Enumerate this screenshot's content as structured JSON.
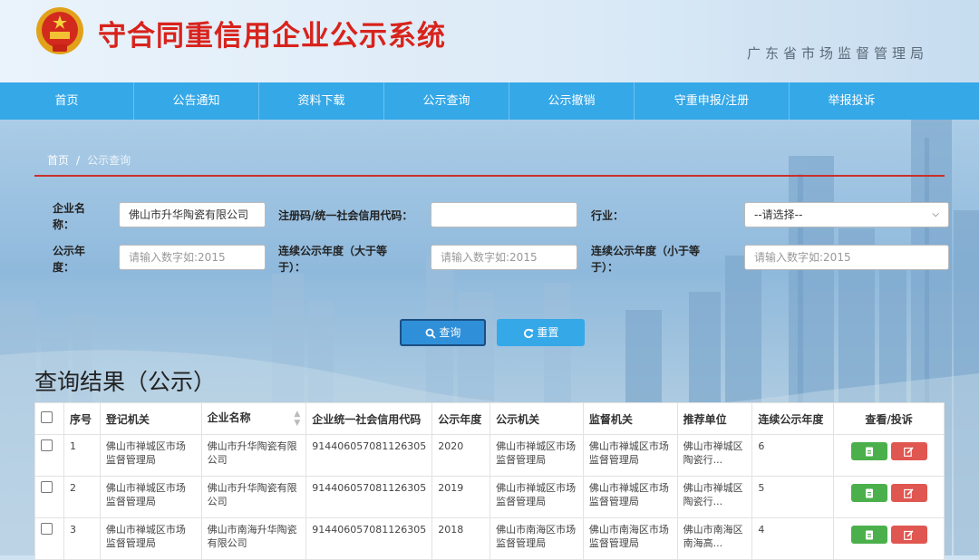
{
  "header": {
    "title": "守合同重信用企业公示系统",
    "authority": "广东省市场监督管理局"
  },
  "nav": [
    "首页",
    "公告通知",
    "资料下载",
    "公示查询",
    "公示撤销",
    "守重申报/注册",
    "举报投诉"
  ],
  "breadcrumb": {
    "home": "首页",
    "separator": "/",
    "current": "公示查询"
  },
  "form": {
    "company_label_1": "企业名",
    "company_label_2": "称：",
    "company_value": "佛山市升华陶瓷有限公司",
    "credit_code_label": "注册码/统一社会信用代码：",
    "credit_code_value": "",
    "industry_label": "行业：",
    "industry_selected": "--请选择--",
    "year_label_1": "公示年",
    "year_label_2": "度：",
    "year_placeholder": "请输入数字如:2015",
    "consec_gt_label_1": "连续公示年度（大于等",
    "consec_gt_label_2": "于）：",
    "consec_gt_placeholder": "请输入数字如:2015",
    "consec_lt_label_1": "连续公示年度（小于等",
    "consec_lt_label_2": "于）：",
    "consec_lt_placeholder": "请输入数字如:2015",
    "query_label": "查询",
    "reset_label": "重置"
  },
  "results": {
    "title": "查询结果（公示）",
    "columns": [
      "序号",
      "登记机关",
      "企业名称",
      "企业统一社会信用代码",
      "公示年度",
      "公示机关",
      "监督机关",
      "推荐单位",
      "连续公示年度",
      "查看/投诉"
    ],
    "rows": [
      {
        "no": "1",
        "reg": "佛山市禅城区市场监督管理局",
        "name": "佛山市升华陶瓷有限公司",
        "code": "914406057081126305",
        "year": "2020",
        "pub": "佛山市禅城区市场监督管理局",
        "sup": "佛山市禅城区市场监督管理局",
        "rec": "佛山市禅城区陶瓷行...",
        "consec": "6"
      },
      {
        "no": "2",
        "reg": "佛山市禅城区市场监督管理局",
        "name": "佛山市升华陶瓷有限公司",
        "code": "914406057081126305",
        "year": "2019",
        "pub": "佛山市禅城区市场监督管理局",
        "sup": "佛山市禅城区市场监督管理局",
        "rec": "佛山市禅城区陶瓷行...",
        "consec": "5"
      },
      {
        "no": "3",
        "reg": "佛山市禅城区市场监督管理局",
        "name": "佛山市南海升华陶瓷有限公司",
        "code": "914406057081126305",
        "year": "2018",
        "pub": "佛山市南海区市场监督管理局",
        "sup": "佛山市南海区市场监督管理局",
        "rec": "佛山市南海区南海高...",
        "consec": "4"
      }
    ]
  },
  "colors": {
    "nav": "#35a8e8",
    "title_red": "#d8231c",
    "view_green": "#4bb04b",
    "report_red": "#e05650"
  }
}
